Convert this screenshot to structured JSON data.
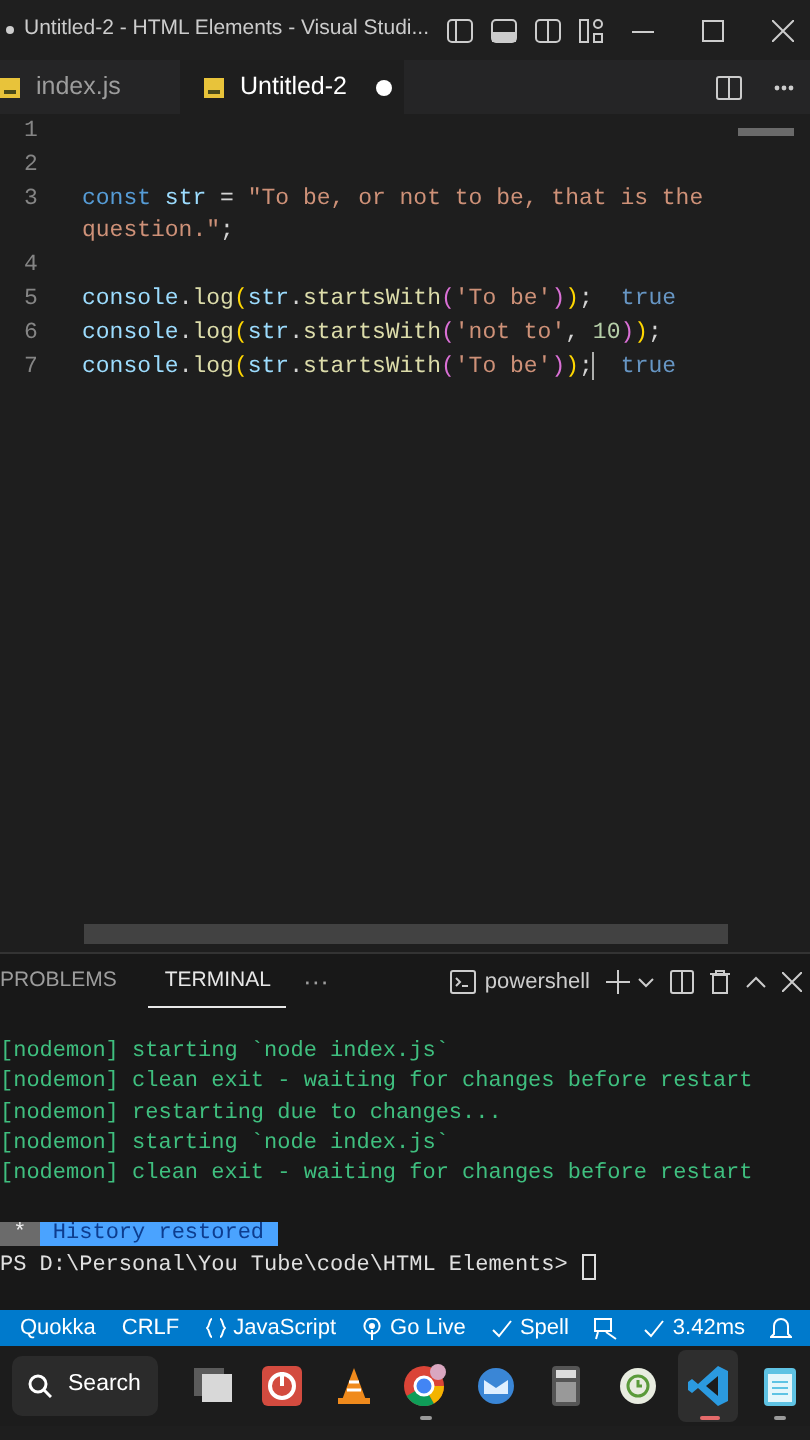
{
  "window": {
    "title": "Untitled-2 - HTML Elements - Visual Studi...",
    "dirty": true
  },
  "editor_tabs": [
    {
      "label": "index.js",
      "selected": false
    },
    {
      "label": "Untitled-2",
      "selected": true,
      "dirty": true
    }
  ],
  "code_lines": [
    {
      "number": "1"
    },
    {
      "number": "2"
    },
    {
      "number": "3",
      "rows": [
        [
          {
            "kind": "keyword",
            "text": "const"
          },
          {
            "kind": "space",
            "text": " "
          },
          {
            "kind": "var",
            "text": "str"
          },
          {
            "kind": "punct",
            "text": " = "
          },
          {
            "kind": "string",
            "text": "\"To be, or not to be, that is the"
          }
        ],
        [
          {
            "kind": "string",
            "text": "question.\""
          },
          {
            "kind": "punct",
            "text": ";"
          }
        ]
      ]
    },
    {
      "number": "4"
    },
    {
      "number": "5",
      "rows": [
        [
          {
            "kind": "var",
            "text": "console"
          },
          {
            "kind": "punct",
            "text": "."
          },
          {
            "kind": "fn",
            "text": "log"
          },
          {
            "kind": "bracket1",
            "text": "("
          },
          {
            "kind": "var",
            "text": "str"
          },
          {
            "kind": "punct",
            "text": "."
          },
          {
            "kind": "fn",
            "text": "startsWith"
          },
          {
            "kind": "bracket2",
            "text": "("
          },
          {
            "kind": "string",
            "text": "'To be'"
          },
          {
            "kind": "bracket2",
            "text": ")"
          },
          {
            "kind": "bracket1",
            "text": ")"
          },
          {
            "kind": "punct",
            "text": ";"
          }
        ]
      ],
      "result": "true"
    },
    {
      "number": "6",
      "rows": [
        [
          {
            "kind": "var",
            "text": "console"
          },
          {
            "kind": "punct",
            "text": "."
          },
          {
            "kind": "fn",
            "text": "log"
          },
          {
            "kind": "bracket1",
            "text": "("
          },
          {
            "kind": "var",
            "text": "str"
          },
          {
            "kind": "punct",
            "text": "."
          },
          {
            "kind": "fn",
            "text": "startsWith"
          },
          {
            "kind": "bracket2",
            "text": "("
          },
          {
            "kind": "string",
            "text": "'not to'"
          },
          {
            "kind": "punct",
            "text": ", "
          },
          {
            "kind": "number",
            "text": "10"
          },
          {
            "kind": "bracket2",
            "text": ")"
          },
          {
            "kind": "bracket1",
            "text": ")"
          },
          {
            "kind": "punct",
            "text": ";"
          }
        ]
      ]
    },
    {
      "number": "7",
      "rows": [
        [
          {
            "kind": "var",
            "text": "console"
          },
          {
            "kind": "punct",
            "text": "."
          },
          {
            "kind": "fn",
            "text": "log"
          },
          {
            "kind": "bracket1",
            "text": "("
          },
          {
            "kind": "var",
            "text": "str"
          },
          {
            "kind": "punct",
            "text": "."
          },
          {
            "kind": "fn",
            "text": "startsWith"
          },
          {
            "kind": "bracket2",
            "text": "("
          },
          {
            "kind": "string",
            "text": "'To be'"
          },
          {
            "kind": "bracket2",
            "text": ")"
          },
          {
            "kind": "bracket1",
            "text": ")"
          },
          {
            "kind": "punct",
            "text": ";"
          }
        ]
      ],
      "result": "true",
      "cursor": true
    }
  ],
  "panel": {
    "tabs": [
      {
        "label": "PROBLEMS",
        "selected": false
      },
      {
        "label": "TERMINAL",
        "selected": true
      }
    ],
    "more": "···",
    "shell": "powershell"
  },
  "terminal": {
    "lines": [
      "[nodemon] starting `node index.js`",
      "[nodemon] clean exit - waiting for changes before restart",
      "[nodemon] restarting due to changes...",
      "[nodemon] starting `node index.js`",
      "[nodemon] clean exit - waiting for changes before restart"
    ],
    "history_mark": "*",
    "history": "History restored",
    "prompt": "PS D:\\Personal\\You Tube\\code\\HTML Elements>"
  },
  "status_bar": [
    {
      "kind": "text",
      "label": "Quokka"
    },
    {
      "kind": "text",
      "label": "CRLF"
    },
    {
      "kind": "language",
      "label": "JavaScript"
    },
    {
      "kind": "live",
      "label": "Go Live"
    },
    {
      "kind": "check",
      "label": "Spell"
    },
    {
      "kind": "feedback"
    },
    {
      "kind": "check",
      "label": "3.42ms"
    },
    {
      "kind": "bell"
    }
  ],
  "taskbar": {
    "search": "Search",
    "apps": [
      {
        "kind": "windows",
        "open": false,
        "active": false
      },
      {
        "kind": "power",
        "open": false,
        "active": false
      },
      {
        "kind": "cone",
        "open": false,
        "active": false
      },
      {
        "kind": "browser",
        "open": true,
        "active": false
      },
      {
        "kind": "mail",
        "open": false,
        "active": false
      },
      {
        "kind": "calculator",
        "open": false,
        "active": false
      },
      {
        "kind": "clock",
        "open": false,
        "active": false
      },
      {
        "kind": "code",
        "open": true,
        "active": true
      },
      {
        "kind": "notepad",
        "open": true,
        "active": false
      }
    ]
  }
}
